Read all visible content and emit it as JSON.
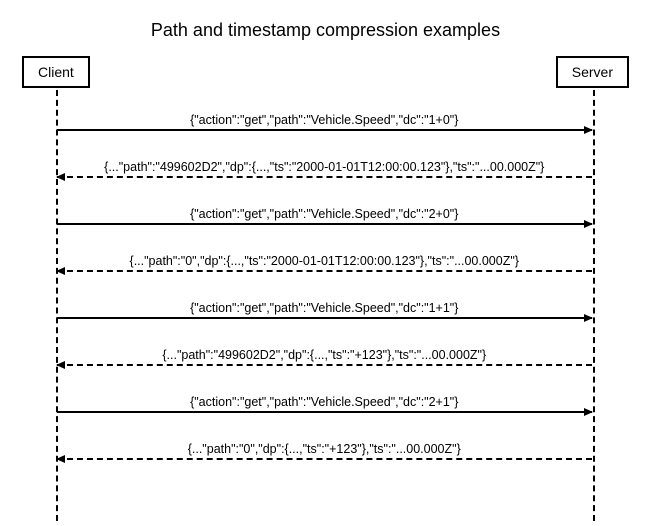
{
  "title": "Path and timestamp compression examples",
  "actors": {
    "client": "Client",
    "server": "Server"
  },
  "messages": [
    {
      "direction": "right",
      "style": "solid",
      "text": "{\"action\":\"get\",\"path\":\"Vehicle.Speed\",\"dc\":\"1+0\"}"
    },
    {
      "direction": "left",
      "style": "dashed",
      "text": "{...\"path\":\"499602D2\",\"dp\":{...,\"ts\":\"2000-01-01T12:00:00.123\"},\"ts\":\"...00.000Z\"}"
    },
    {
      "direction": "right",
      "style": "solid",
      "text": "{\"action\":\"get\",\"path\":\"Vehicle.Speed\",\"dc\":\"2+0\"}"
    },
    {
      "direction": "left",
      "style": "dashed",
      "text": "{...\"path\":\"0\",\"dp\":{...,\"ts\":\"2000-01-01T12:00:00.123\"},\"ts\":\"...00.000Z\"}"
    },
    {
      "direction": "right",
      "style": "solid",
      "text": "{\"action\":\"get\",\"path\":\"Vehicle.Speed\",\"dc\":\"1+1\"}"
    },
    {
      "direction": "left",
      "style": "dashed",
      "text": "{...\"path\":\"499602D2\",\"dp\":{...,\"ts\":\"+123\"},\"ts\":\"...00.000Z\"}"
    },
    {
      "direction": "right",
      "style": "solid",
      "text": "{\"action\":\"get\",\"path\":\"Vehicle.Speed\",\"dc\":\"2+1\"}"
    },
    {
      "direction": "left",
      "style": "dashed",
      "text": "{...\"path\":\"0\",\"dp\":{...,\"ts\":\"+123\"},\"ts\":\"...00.000Z\"}"
    }
  ]
}
